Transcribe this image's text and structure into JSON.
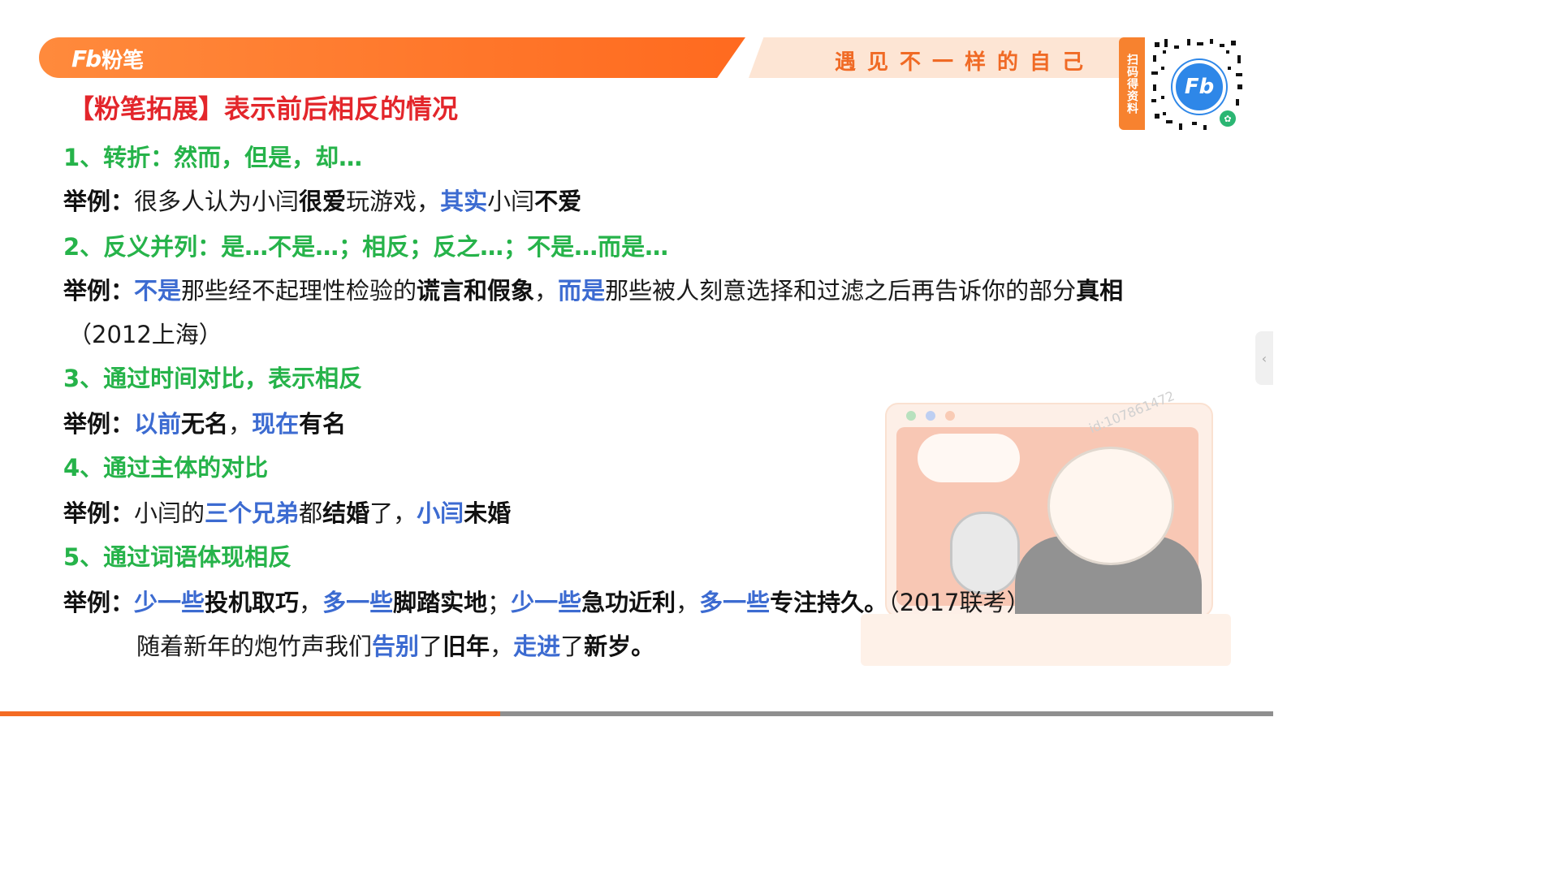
{
  "header": {
    "brand": "粉笔",
    "brand_logo": "Fb",
    "slogan": "遇见不一样的自己",
    "qr_tab": "扫码得资料",
    "qr_logo": "Fb"
  },
  "title": "【粉笔拓展】表示前后相反的情况",
  "sections": {
    "s1": {
      "heading": "1、转折：然而，但是，却…"
    },
    "ex1": {
      "label": "举例：",
      "p1": "很多人认为小闫",
      "p2": "很爱",
      "p3": "玩游戏，",
      "p4": "其实",
      "p5": "小闫",
      "p6": "不爱"
    },
    "s2": {
      "heading": "2、反义并列：是…不是…；相反；反之…；不是…而是…"
    },
    "ex2": {
      "label": "举例：",
      "p1": "不是",
      "p2": "那些经不起理性检验的",
      "p3": "谎言和假象",
      "p4": "，",
      "p5": "而是",
      "p6": "那些被人刻意选择和过滤之后再告诉你的部分",
      "p7": "真相",
      "source": "（2012上海）"
    },
    "s3": {
      "heading": "3、通过时间对比，表示相反"
    },
    "ex3": {
      "label": "举例：",
      "p1": "以前",
      "p2": "无名",
      "p3": "，",
      "p4": "现在",
      "p5": "有名"
    },
    "s4": {
      "heading": "4、通过主体的对比"
    },
    "ex4": {
      "label": "举例：",
      "p1": "小闫的",
      "p2": "三个兄弟",
      "p3": "都",
      "p4": "结婚",
      "p5": "了，",
      "p6": "小闫",
      "p7": "未婚"
    },
    "s5": {
      "heading": "5、通过词语体现相反"
    },
    "ex5": {
      "label": "举例：",
      "p1": "少一些",
      "p2": "投机取巧",
      "p3": "，",
      "p4": "多一些",
      "p5": "脚踏实地",
      "p6": "；",
      "p7": "少一些",
      "p8": "急功近利",
      "p9": "，",
      "p10": "多一些",
      "p11": "专注持久。",
      "p12": "（2017联考）"
    },
    "ex6": {
      "p1": "随着新年的炮竹声我们",
      "p2": "告别",
      "p3": "了",
      "p4": "旧年",
      "p5": "，",
      "p6": "走进",
      "p7": "了",
      "p8": "新岁。"
    }
  },
  "watermark": "id:107861472",
  "side_handle_icon": "chevron-left-icon",
  "colors": {
    "accent_orange": "#f46b23",
    "title_red": "#e3262b",
    "heading_green": "#26b34a",
    "highlight_blue": "#3c6bd1"
  }
}
